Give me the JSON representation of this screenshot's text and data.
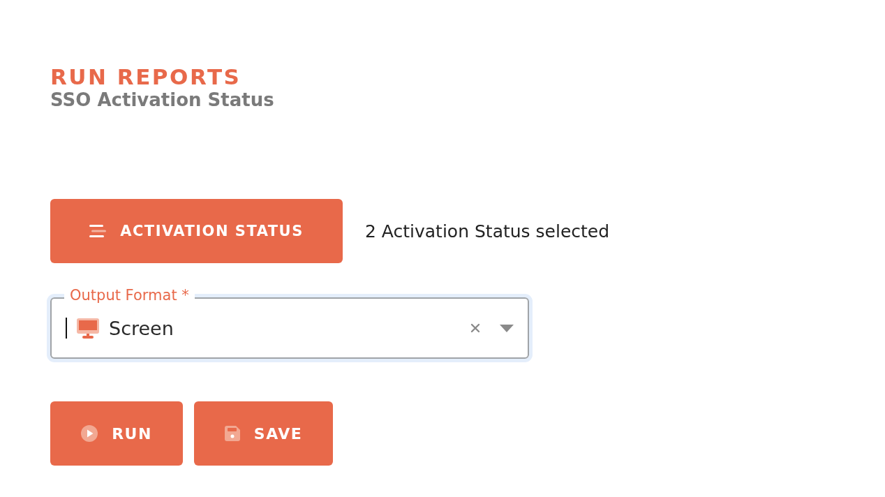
{
  "header": {
    "title": "RUN REPORTS",
    "subtitle": "SSO Activation Status"
  },
  "filter": {
    "button_label": "ACTIVATION STATUS",
    "summary": "2 Activation Status selected"
  },
  "output_format": {
    "label": "Output Format *",
    "value": "Screen",
    "focused": true
  },
  "actions": [
    {
      "kind": "run",
      "label": "RUN"
    },
    {
      "kind": "save",
      "label": "SAVE"
    }
  ]
}
